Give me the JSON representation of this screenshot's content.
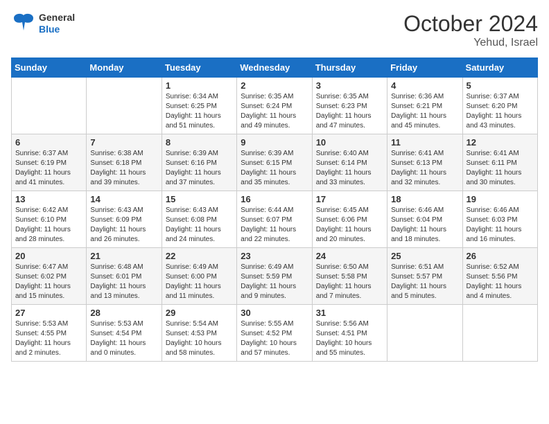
{
  "logo": {
    "general": "General",
    "blue": "Blue"
  },
  "title": "October 2024",
  "location": "Yehud, Israel",
  "days_of_week": [
    "Sunday",
    "Monday",
    "Tuesday",
    "Wednesday",
    "Thursday",
    "Friday",
    "Saturday"
  ],
  "weeks": [
    [
      {
        "day": "",
        "info": ""
      },
      {
        "day": "",
        "info": ""
      },
      {
        "day": "1",
        "info": "Sunrise: 6:34 AM\nSunset: 6:25 PM\nDaylight: 11 hours and 51 minutes."
      },
      {
        "day": "2",
        "info": "Sunrise: 6:35 AM\nSunset: 6:24 PM\nDaylight: 11 hours and 49 minutes."
      },
      {
        "day": "3",
        "info": "Sunrise: 6:35 AM\nSunset: 6:23 PM\nDaylight: 11 hours and 47 minutes."
      },
      {
        "day": "4",
        "info": "Sunrise: 6:36 AM\nSunset: 6:21 PM\nDaylight: 11 hours and 45 minutes."
      },
      {
        "day": "5",
        "info": "Sunrise: 6:37 AM\nSunset: 6:20 PM\nDaylight: 11 hours and 43 minutes."
      }
    ],
    [
      {
        "day": "6",
        "info": "Sunrise: 6:37 AM\nSunset: 6:19 PM\nDaylight: 11 hours and 41 minutes."
      },
      {
        "day": "7",
        "info": "Sunrise: 6:38 AM\nSunset: 6:18 PM\nDaylight: 11 hours and 39 minutes."
      },
      {
        "day": "8",
        "info": "Sunrise: 6:39 AM\nSunset: 6:16 PM\nDaylight: 11 hours and 37 minutes."
      },
      {
        "day": "9",
        "info": "Sunrise: 6:39 AM\nSunset: 6:15 PM\nDaylight: 11 hours and 35 minutes."
      },
      {
        "day": "10",
        "info": "Sunrise: 6:40 AM\nSunset: 6:14 PM\nDaylight: 11 hours and 33 minutes."
      },
      {
        "day": "11",
        "info": "Sunrise: 6:41 AM\nSunset: 6:13 PM\nDaylight: 11 hours and 32 minutes."
      },
      {
        "day": "12",
        "info": "Sunrise: 6:41 AM\nSunset: 6:11 PM\nDaylight: 11 hours and 30 minutes."
      }
    ],
    [
      {
        "day": "13",
        "info": "Sunrise: 6:42 AM\nSunset: 6:10 PM\nDaylight: 11 hours and 28 minutes."
      },
      {
        "day": "14",
        "info": "Sunrise: 6:43 AM\nSunset: 6:09 PM\nDaylight: 11 hours and 26 minutes."
      },
      {
        "day": "15",
        "info": "Sunrise: 6:43 AM\nSunset: 6:08 PM\nDaylight: 11 hours and 24 minutes."
      },
      {
        "day": "16",
        "info": "Sunrise: 6:44 AM\nSunset: 6:07 PM\nDaylight: 11 hours and 22 minutes."
      },
      {
        "day": "17",
        "info": "Sunrise: 6:45 AM\nSunset: 6:06 PM\nDaylight: 11 hours and 20 minutes."
      },
      {
        "day": "18",
        "info": "Sunrise: 6:46 AM\nSunset: 6:04 PM\nDaylight: 11 hours and 18 minutes."
      },
      {
        "day": "19",
        "info": "Sunrise: 6:46 AM\nSunset: 6:03 PM\nDaylight: 11 hours and 16 minutes."
      }
    ],
    [
      {
        "day": "20",
        "info": "Sunrise: 6:47 AM\nSunset: 6:02 PM\nDaylight: 11 hours and 15 minutes."
      },
      {
        "day": "21",
        "info": "Sunrise: 6:48 AM\nSunset: 6:01 PM\nDaylight: 11 hours and 13 minutes."
      },
      {
        "day": "22",
        "info": "Sunrise: 6:49 AM\nSunset: 6:00 PM\nDaylight: 11 hours and 11 minutes."
      },
      {
        "day": "23",
        "info": "Sunrise: 6:49 AM\nSunset: 5:59 PM\nDaylight: 11 hours and 9 minutes."
      },
      {
        "day": "24",
        "info": "Sunrise: 6:50 AM\nSunset: 5:58 PM\nDaylight: 11 hours and 7 minutes."
      },
      {
        "day": "25",
        "info": "Sunrise: 6:51 AM\nSunset: 5:57 PM\nDaylight: 11 hours and 5 minutes."
      },
      {
        "day": "26",
        "info": "Sunrise: 6:52 AM\nSunset: 5:56 PM\nDaylight: 11 hours and 4 minutes."
      }
    ],
    [
      {
        "day": "27",
        "info": "Sunrise: 5:53 AM\nSunset: 4:55 PM\nDaylight: 11 hours and 2 minutes."
      },
      {
        "day": "28",
        "info": "Sunrise: 5:53 AM\nSunset: 4:54 PM\nDaylight: 11 hours and 0 minutes."
      },
      {
        "day": "29",
        "info": "Sunrise: 5:54 AM\nSunset: 4:53 PM\nDaylight: 10 hours and 58 minutes."
      },
      {
        "day": "30",
        "info": "Sunrise: 5:55 AM\nSunset: 4:52 PM\nDaylight: 10 hours and 57 minutes."
      },
      {
        "day": "31",
        "info": "Sunrise: 5:56 AM\nSunset: 4:51 PM\nDaylight: 10 hours and 55 minutes."
      },
      {
        "day": "",
        "info": ""
      },
      {
        "day": "",
        "info": ""
      }
    ]
  ]
}
